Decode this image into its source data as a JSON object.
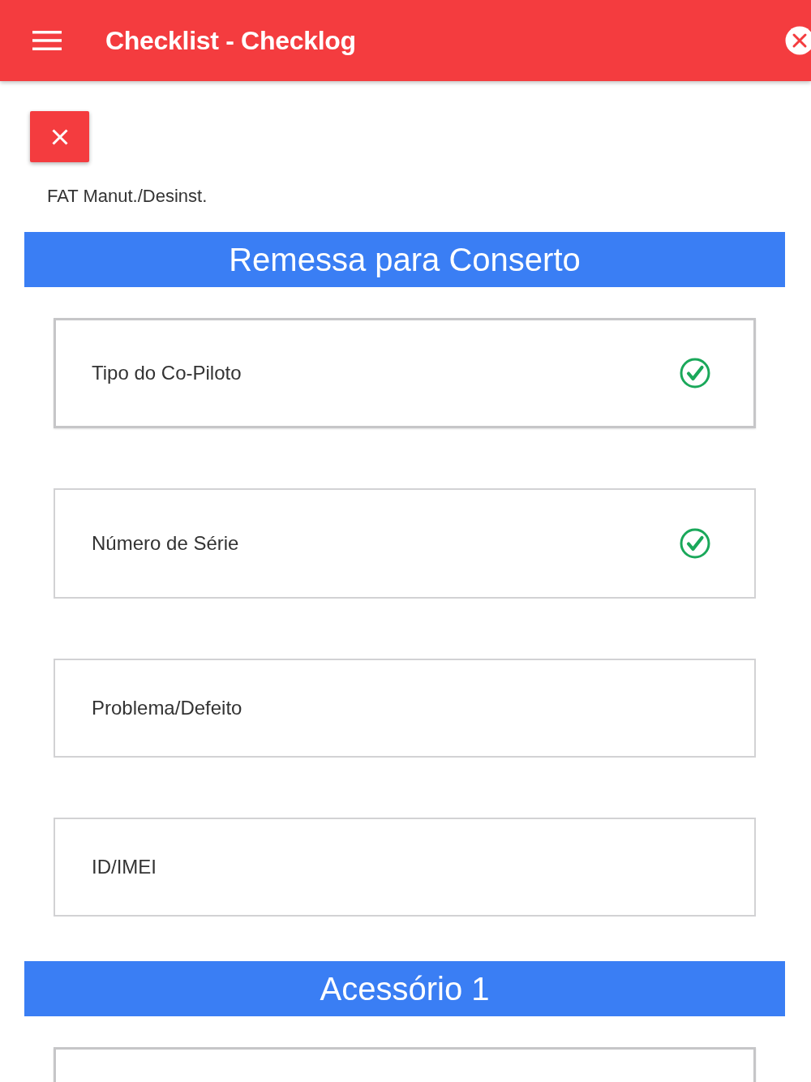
{
  "app_bar": {
    "title": "Checklist - Checklog"
  },
  "subtitle": "FAT Manut./Desinst.",
  "sections": [
    {
      "title": "Remessa para Conserto",
      "items": [
        {
          "label": "Tipo do Co-Piloto",
          "checked": true,
          "highlighted": true
        },
        {
          "label": "Número de Série",
          "checked": true,
          "highlighted": false
        },
        {
          "label": "Problema/Defeito",
          "checked": false,
          "highlighted": false
        },
        {
          "label": "ID/IMEI",
          "checked": false,
          "highlighted": false
        }
      ]
    },
    {
      "title": "Acessório 1",
      "items": [
        {
          "checked": false,
          "highlighted": true
        }
      ]
    }
  ]
}
